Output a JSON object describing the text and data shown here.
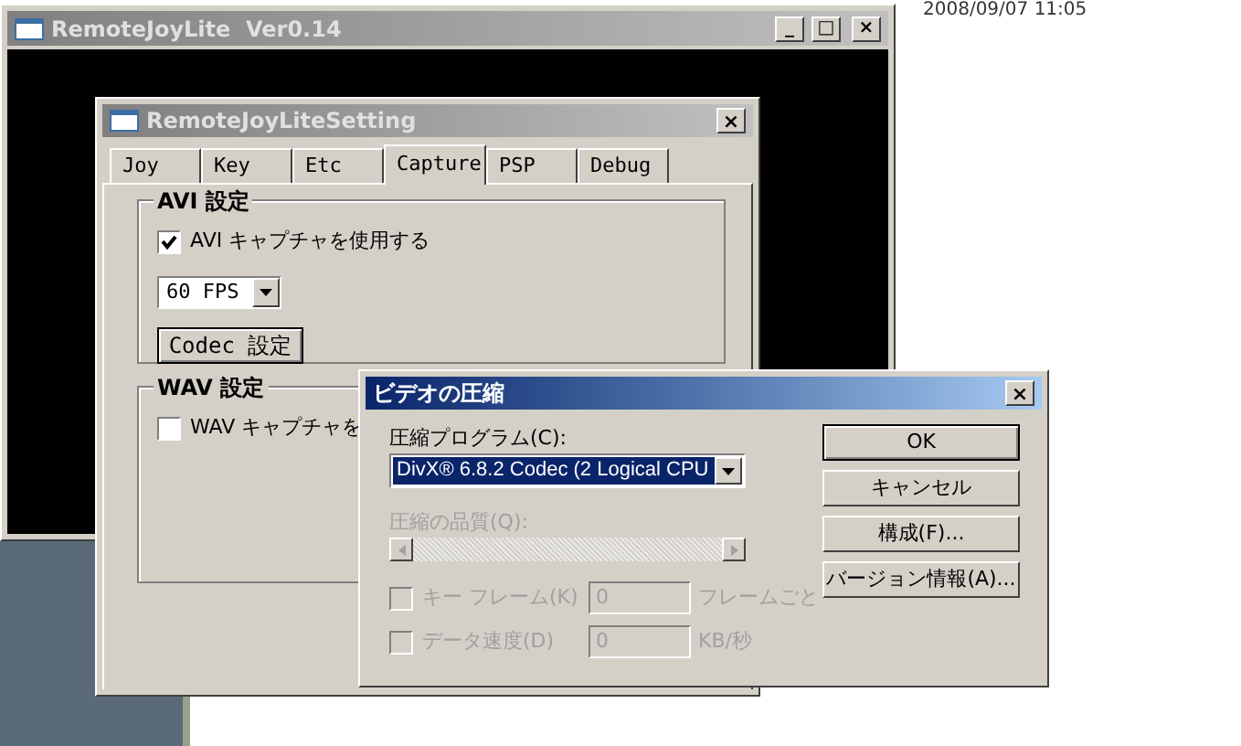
{
  "desktop": {
    "clock": "2008/09/07 11:05"
  },
  "main_window": {
    "title": "RemoteJoyLite  Ver0.14",
    "buttons": [
      "_",
      "□",
      "×"
    ]
  },
  "settings_window": {
    "title": "RemoteJoyLiteSetting",
    "close": "×",
    "tabs": [
      {
        "label": "Joy",
        "selected": false
      },
      {
        "label": "Key",
        "selected": false
      },
      {
        "label": "Etc",
        "selected": false
      },
      {
        "label": "Capture",
        "selected": true
      },
      {
        "label": "PSP",
        "selected": false
      },
      {
        "label": "Debug",
        "selected": false
      }
    ],
    "avi_group": {
      "title": "AVI 設定",
      "checkbox": {
        "label": "AVI キャプチャを使用する",
        "checked": true
      },
      "fps": {
        "value": "60 FPS"
      },
      "codec_button": "Codec 設定"
    },
    "wav_group": {
      "title": "WAV 設定",
      "checkbox": {
        "label": "WAV キャプチャを",
        "checked": false
      }
    }
  },
  "compress_dialog": {
    "title": "ビデオの圧縮",
    "close": "×",
    "program_label": "圧縮プログラム(C):",
    "program": {
      "value": "DivX® 6.8.2 Codec (2 Logical CPU"
    },
    "quality_label": "圧縮の品質(Q):",
    "quality_disabled": true,
    "options": [
      {
        "label": "キー フレーム(K)",
        "checked": false,
        "disabled": true,
        "value": "0",
        "unit": "フレームごと"
      },
      {
        "label": "データ速度(D)",
        "checked": false,
        "disabled": true,
        "value": "0",
        "unit": "KB/秒"
      }
    ],
    "buttons": [
      {
        "label": "OK",
        "default": true
      },
      {
        "label": "キャンセル",
        "default": false
      },
      {
        "label": "構成(F)...",
        "default": false
      },
      {
        "label": "バージョン情報(A)...",
        "default": false
      }
    ]
  }
}
